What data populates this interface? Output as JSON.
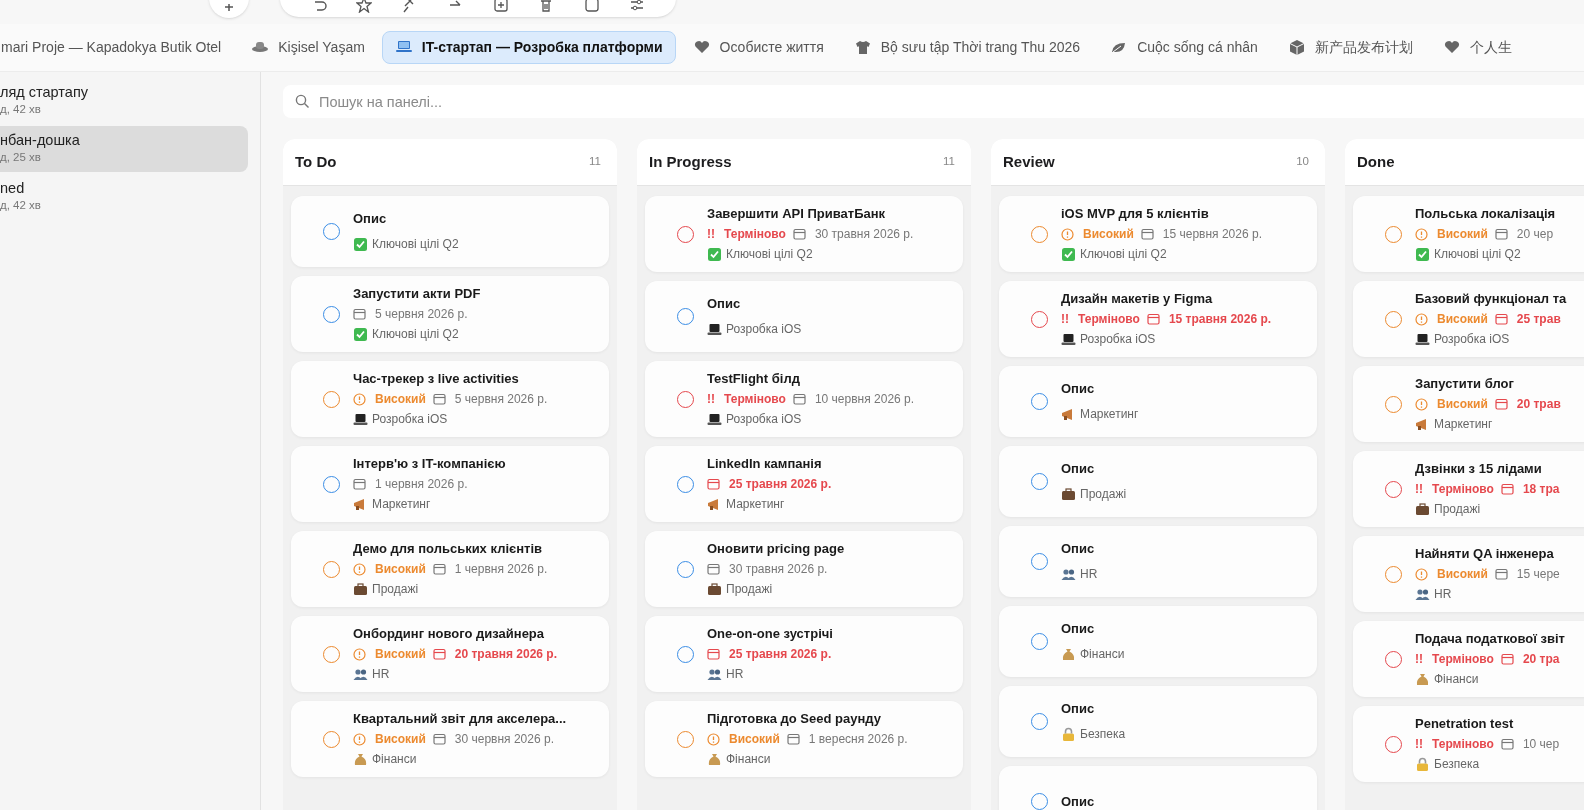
{
  "tabs": [
    {
      "label": "mari Proje — Kapadokya Butik Otel",
      "selected": false
    },
    {
      "label": "Kişisel Yaşam",
      "selected": false,
      "kind": "hat"
    },
    {
      "label": "IT-стартап — Розробка платформи",
      "selected": true,
      "kind": "laptop"
    },
    {
      "label": "Особисте життя",
      "selected": false,
      "kind": "heart"
    },
    {
      "label": "Bộ sưu tập Thời trang Thu 2026",
      "selected": false,
      "kind": "shirt"
    },
    {
      "label": "Cuộc sống cá nhân",
      "selected": false,
      "kind": "leaf"
    },
    {
      "label": "新产品发布计划",
      "selected": false,
      "kind": "cube"
    },
    {
      "label": "个人生",
      "selected": false,
      "kind": "heart"
    }
  ],
  "sidebar": {
    "items": [
      {
        "title": "ляд стартапу",
        "subtitle": "д, 42 хв",
        "selected": false
      },
      {
        "title": "нбан-дошка",
        "subtitle": "д, 25 хв",
        "selected": true
      },
      {
        "title": "ned",
        "subtitle": "д, 42 хв",
        "selected": false
      }
    ]
  },
  "search": {
    "placeholder": "Пошук на панелі..."
  },
  "columns": [
    {
      "title": "To Do",
      "count": "11",
      "cards": [
        {
          "title": "Опис",
          "category": {
            "kind": "goals",
            "label": "Ключові цілі Q2"
          }
        },
        {
          "title": "Запустити акти PDF",
          "date": {
            "text": "5 червня 2026 р.",
            "overdue": false
          },
          "category": {
            "kind": "goals",
            "label": "Ключові цілі Q2"
          }
        },
        {
          "title": "Час-трекер з live activities",
          "priority": {
            "kind": "high",
            "label": "Високий"
          },
          "date": {
            "text": "5 червня 2026 р.",
            "overdue": false
          },
          "category": {
            "kind": "laptop",
            "label": "Розробка iOS"
          }
        },
        {
          "title": "Інтерв'ю з IT-компанією",
          "date": {
            "text": "1 червня 2026 р.",
            "overdue": false
          },
          "category": {
            "kind": "megaphone",
            "label": "Маркетинг"
          }
        },
        {
          "title": "Демо для польських клієнтів",
          "priority": {
            "kind": "high",
            "label": "Високий"
          },
          "date": {
            "text": "1 червня 2026 р.",
            "overdue": false
          },
          "category": {
            "kind": "briefcase",
            "label": "Продажі"
          }
        },
        {
          "title": "Онбординг нового дизайнера",
          "priority": {
            "kind": "high",
            "label": "Високий"
          },
          "date": {
            "text": "20 травня 2026 р.",
            "overdue": true
          },
          "category": {
            "kind": "people",
            "label": "HR"
          }
        },
        {
          "title": "Квартальний звіт для акселера...",
          "priority": {
            "kind": "high",
            "label": "Високий"
          },
          "date": {
            "text": "30 червня 2026 р.",
            "overdue": false
          },
          "category": {
            "kind": "money",
            "label": "Фінанси"
          }
        }
      ]
    },
    {
      "title": "In Progress",
      "count": "11",
      "cards": [
        {
          "title": "Завершити API ПриватБанк",
          "priority": {
            "kind": "urgent",
            "mark": "!!",
            "label": "Терміново"
          },
          "date": {
            "text": "30 травня 2026 р.",
            "overdue": false
          },
          "category": {
            "kind": "goals",
            "label": "Ключові цілі Q2"
          }
        },
        {
          "title": "Опис",
          "category": {
            "kind": "laptop",
            "label": "Розробка iOS"
          }
        },
        {
          "title": "TestFlight білд",
          "priority": {
            "kind": "urgent",
            "mark": "!!",
            "label": "Терміново"
          },
          "date": {
            "text": "10 червня 2026 р.",
            "overdue": false
          },
          "category": {
            "kind": "laptop",
            "label": "Розробка iOS"
          }
        },
        {
          "title": "LinkedIn кампанія",
          "date": {
            "text": "25 травня 2026 р.",
            "overdue": true
          },
          "category": {
            "kind": "megaphone",
            "label": "Маркетинг"
          }
        },
        {
          "title": "Оновити pricing page",
          "date": {
            "text": "30 травня 2026 р.",
            "overdue": false
          },
          "category": {
            "kind": "briefcase",
            "label": "Продажі"
          }
        },
        {
          "title": "One-on-one зустрічі",
          "date": {
            "text": "25 травня 2026 р.",
            "overdue": true
          },
          "category": {
            "kind": "people",
            "label": "HR"
          }
        },
        {
          "title": "Підготовка до Seed раунду",
          "priority": {
            "kind": "high",
            "label": "Високий"
          },
          "date": {
            "text": "1 вересня 2026 р.",
            "overdue": false
          },
          "category": {
            "kind": "money",
            "label": "Фінанси"
          }
        }
      ]
    },
    {
      "title": "Review",
      "count": "10",
      "cards": [
        {
          "title": "iOS MVP для 5 клієнтів",
          "priority": {
            "kind": "high",
            "label": "Високий"
          },
          "date": {
            "text": "15 червня 2026 р.",
            "overdue": false
          },
          "category": {
            "kind": "goals",
            "label": "Ключові цілі Q2"
          }
        },
        {
          "title": "Дизайн макетів у Figma",
          "priority": {
            "kind": "urgent",
            "mark": "!!",
            "label": "Терміново"
          },
          "date": {
            "text": "15 травня 2026 р.",
            "overdue": true
          },
          "category": {
            "kind": "laptop",
            "label": "Розробка iOS"
          }
        },
        {
          "title": "Опис",
          "category": {
            "kind": "megaphone",
            "label": "Маркетинг"
          }
        },
        {
          "title": "Опис",
          "category": {
            "kind": "briefcase",
            "label": "Продажі"
          }
        },
        {
          "title": "Опис",
          "category": {
            "kind": "people",
            "label": "HR"
          }
        },
        {
          "title": "Опис",
          "category": {
            "kind": "money",
            "label": "Фінанси"
          }
        },
        {
          "title": "Опис",
          "category": {
            "kind": "lock",
            "label": "Безпека"
          }
        },
        {
          "title": "Опис"
        }
      ]
    },
    {
      "title": "Done",
      "cards": [
        {
          "title": "Польська локалізація",
          "priority": {
            "kind": "high",
            "label": "Високий"
          },
          "date": {
            "text": "20 чер",
            "overdue": false
          },
          "category": {
            "kind": "goals",
            "label": "Ключові цілі Q2"
          }
        },
        {
          "title": "Базовий функціонал та",
          "priority": {
            "kind": "high",
            "label": "Високий"
          },
          "date": {
            "text": "25 трав",
            "overdue": true
          },
          "category": {
            "kind": "laptop",
            "label": "Розробка iOS"
          }
        },
        {
          "title": "Запустити блог",
          "priority": {
            "kind": "high",
            "label": "Високий"
          },
          "date": {
            "text": "20 трав",
            "overdue": true
          },
          "category": {
            "kind": "megaphone",
            "label": "Маркетинг"
          }
        },
        {
          "title": "Дзвінки з 15 лідами",
          "priority": {
            "kind": "urgent",
            "mark": "!!",
            "label": "Терміново"
          },
          "date": {
            "text": "18 тра",
            "overdue": true
          },
          "category": {
            "kind": "briefcase",
            "label": "Продажі"
          }
        },
        {
          "title": "Найняти QA інженера",
          "priority": {
            "kind": "high",
            "label": "Високий"
          },
          "date": {
            "text": "15 чере",
            "overdue": false
          },
          "category": {
            "kind": "people",
            "label": "HR"
          }
        },
        {
          "title": "Подача податкової звіт",
          "priority": {
            "kind": "urgent",
            "mark": "!!",
            "label": "Терміново"
          },
          "date": {
            "text": "20 тра",
            "overdue": true
          },
          "category": {
            "kind": "money",
            "label": "Фінанси"
          }
        },
        {
          "title": "Penetration test",
          "priority": {
            "kind": "urgent",
            "mark": "!!",
            "label": "Терміново"
          },
          "date": {
            "text": "10 чер",
            "overdue": false
          },
          "category": {
            "kind": "lock",
            "label": "Безпека"
          }
        }
      ]
    }
  ]
}
